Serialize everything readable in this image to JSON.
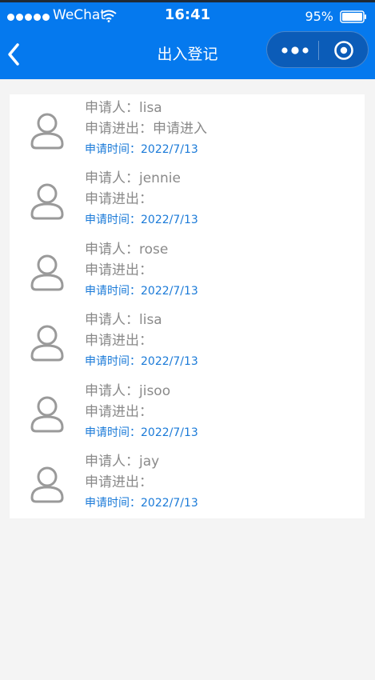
{
  "status_bar": {
    "carrier": "WeChat",
    "time": "16:41",
    "battery": "95%"
  },
  "nav": {
    "title": "出入登记"
  },
  "labels": {
    "applicant": "申请人：",
    "direction": "申请进出：",
    "apply_time": "申请时间："
  },
  "records": [
    {
      "name": "lisa",
      "direction": "申请进入",
      "date": "2022/7/13"
    },
    {
      "name": "jennie",
      "direction": "",
      "date": "2022/7/13"
    },
    {
      "name": "rose",
      "direction": "",
      "date": "2022/7/13"
    },
    {
      "name": "lisa",
      "direction": "",
      "date": "2022/7/13"
    },
    {
      "name": "jisoo",
      "direction": "",
      "date": "2022/7/13"
    },
    {
      "name": "jay",
      "direction": "",
      "date": "2022/7/13"
    }
  ],
  "colors": {
    "header_bg": "#0579ee",
    "capsule_bg": "#0b5cb8",
    "time_text": "#1a7ad8",
    "body_text": "#8a8a8a"
  }
}
